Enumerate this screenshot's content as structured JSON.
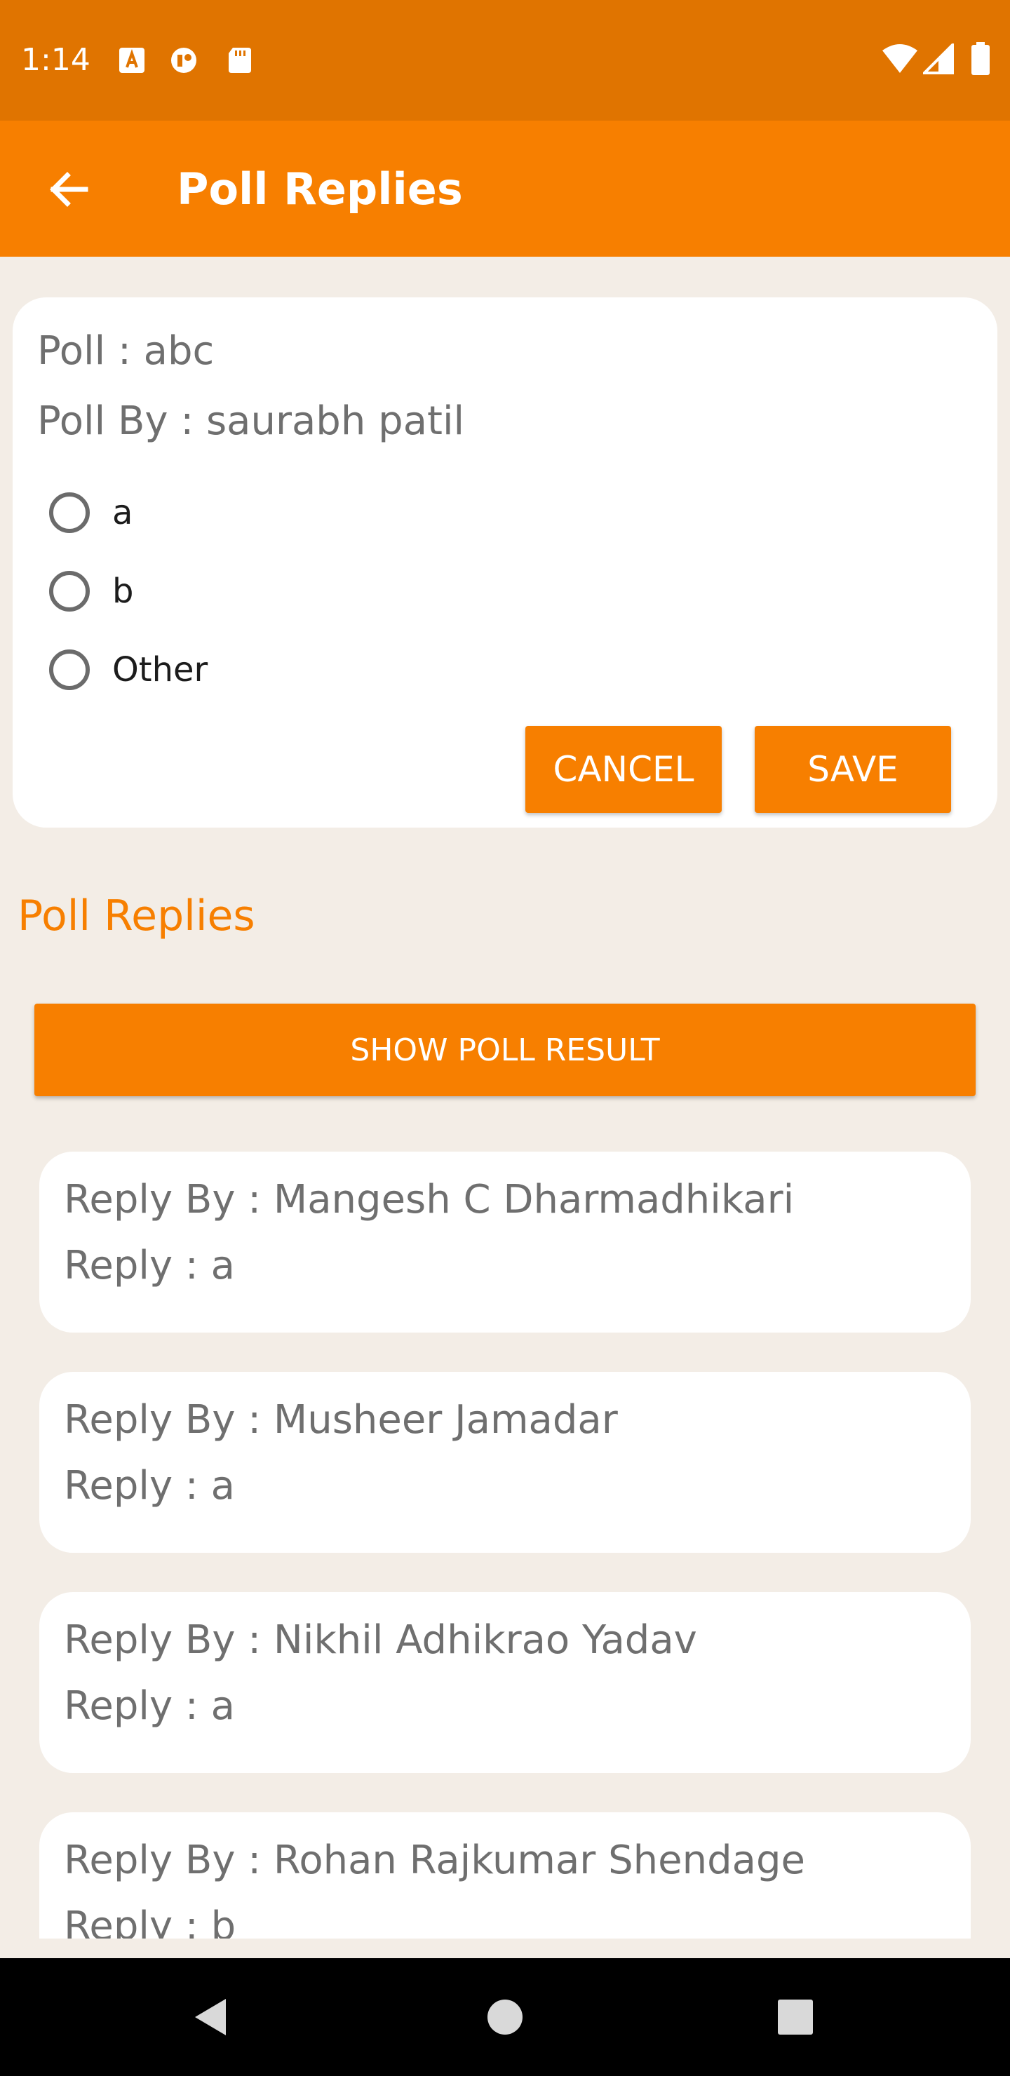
{
  "status_bar": {
    "time": "1:14",
    "icons": [
      "a-badge-icon",
      "privacy-icon",
      "sd-card-icon",
      "wifi-icon",
      "cell-signal-icon",
      "battery-icon"
    ]
  },
  "app_bar": {
    "title": "Poll Replies",
    "back_icon": "arrow-left-icon"
  },
  "poll": {
    "question": "Poll : abc",
    "author": "Poll By : saurabh patil",
    "options": [
      "a",
      "b",
      "Other"
    ],
    "cancel_label": "CANCEL",
    "save_label": "SAVE"
  },
  "replies_section": {
    "title": "Poll Replies",
    "show_result_label": "SHOW POLL RESULT",
    "replies": [
      {
        "by": "Reply By : Mangesh C Dharmadhikari",
        "reply": "Reply : a"
      },
      {
        "by": "Reply By : Musheer Jamadar",
        "reply": "Reply : a"
      },
      {
        "by": "Reply By : Nikhil Adhikrao Yadav",
        "reply": "Reply : a"
      },
      {
        "by": "Reply By : Rohan Rajkumar Shendage",
        "reply": "Reply : b"
      }
    ]
  },
  "nav_bar": {
    "icons": [
      "back-triangle-icon",
      "home-circle-icon",
      "recents-square-icon"
    ]
  },
  "colors": {
    "status_bar": "#e07400",
    "accent": "#f77f00",
    "background": "#f3ede6",
    "card": "#ffffff",
    "text_secondary": "#6f6f6f"
  }
}
